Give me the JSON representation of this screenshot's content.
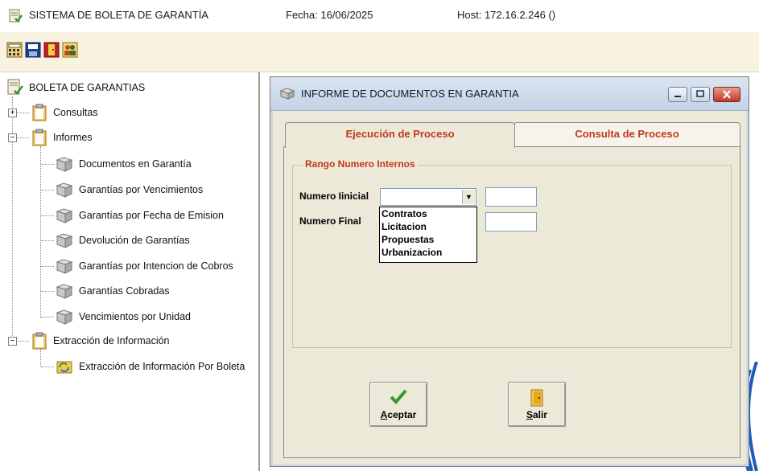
{
  "header": {
    "app_title": "SISTEMA DE BOLETA DE GARANTÍA",
    "fecha": "Fecha: 16/06/2025",
    "host": "Host: 172.16.2.246 ()"
  },
  "toolbar": {
    "buttons": [
      "calculator-icon",
      "save-disk-icon",
      "exit-door-icon",
      "users-icon"
    ]
  },
  "tree": {
    "root": "BOLETA DE GARANTIAS",
    "consultas": "Consultas",
    "informes": "Informes",
    "informes_items": [
      "Documentos en Garantía",
      "Garantías por Vencimientos",
      "Garantías por Fecha de Emision",
      "Devolución de Garantías",
      "Garantías por Intencion de Cobros",
      "Garantías Cobradas",
      "Vencimientos por Unidad"
    ],
    "extraccion": "Extracción de Información",
    "extraccion_items": [
      "Extracción de Información Por Boleta"
    ]
  },
  "dialog": {
    "title": "INFORME DE DOCUMENTOS EN GARANTIA",
    "tabs": [
      "Ejecución de Proceso",
      "Consulta de Proceso"
    ],
    "group_title": "Rango Numero Internos",
    "label_inicial": "Numero Iinicial",
    "label_final": "Numero Final",
    "combo_value": "",
    "dropdown_options": [
      "Contratos",
      "Licitacion",
      "Propuestas",
      "Urbanizacion"
    ],
    "aceptar_first": "A",
    "aceptar_rest": "ceptar",
    "salir_first": "S",
    "salir_rest": "alir"
  },
  "colors": {
    "accent_red": "#c0391b",
    "panel_bg": "#ece9d8",
    "toolbar_bg": "#f7f3e0"
  }
}
